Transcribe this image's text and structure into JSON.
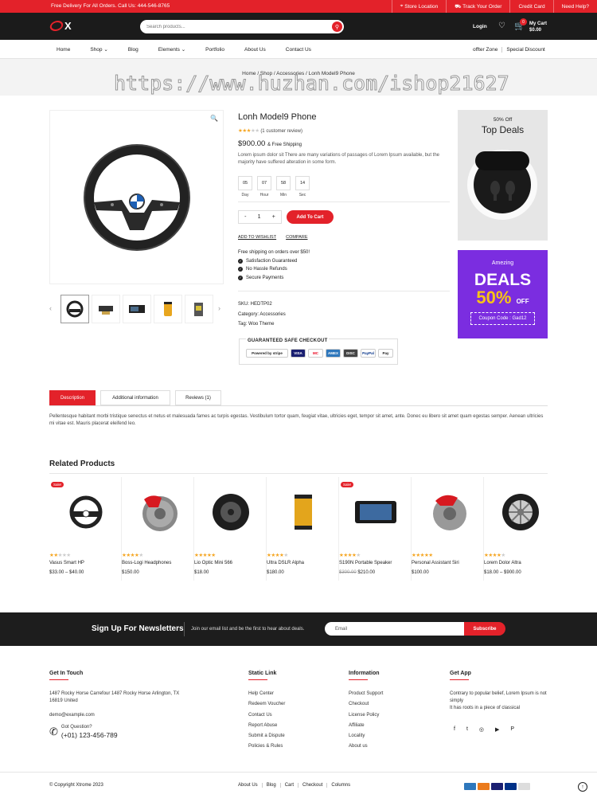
{
  "topbar": {
    "promo": "Free Delivery For All Orders. Call Us: 444-546-8765",
    "links": [
      "Store Location",
      "Track Your Order",
      "Credit Card",
      "Need Help?"
    ]
  },
  "header": {
    "logo": "X",
    "search_placeholder": "Search products...",
    "login": "Login",
    "cart_count": "0",
    "cart_label": "My Cart",
    "cart_total": "$0.00"
  },
  "nav": {
    "items": [
      "Home",
      "Shop ⌄",
      "Blog",
      "Elements ⌄",
      "Portfolio",
      "About Us",
      "Contact Us"
    ],
    "right": [
      "offter Zone",
      "Special Discount"
    ]
  },
  "breadcrumb": "Home / Shop / Accessories / Lonh Model9 Phone",
  "watermark": "https://www.huzhan.com/ishop21627",
  "product": {
    "title": "Lonh Model9 Phone",
    "rating": 3,
    "review": "(1 customer review)",
    "price": "$900.00",
    "shipping": "& Free Shipping",
    "description": "Lorem ipsum dolor sit There are many variations of passages of Lorem Ipsum available, but the majority have suffered alteration in some form.",
    "timer": [
      {
        "value": "05",
        "unit": "Day"
      },
      {
        "value": "07",
        "unit": "Hour"
      },
      {
        "value": "58",
        "unit": "Min"
      },
      {
        "value": "14",
        "unit": "Sec"
      }
    ],
    "qty": "1",
    "qty_minus": "-",
    "qty_plus": "+",
    "add_to_cart": "Add To Cart",
    "wishlist": "ADD TO WISHLIST",
    "compare": "COMPARE",
    "shipping_note": "Free shipping on orders over $50!",
    "features": [
      "Satisfaction Guaranteed",
      "No Hassle Refunds",
      "Secure Payments"
    ],
    "sku": "SKU: HEDTP02",
    "category": "Category: Accessories",
    "tag": "Tag: Woo Theme",
    "safe_title": "GUARANTEED SAFE CHECKOUT",
    "payments": [
      "Powered by stripe",
      "VISA",
      "MC",
      "AMEX",
      "DISC",
      "PayPal",
      "Pay"
    ]
  },
  "deals": {
    "off": "50% Off",
    "top": "Top Deals",
    "amezing": "Amezing",
    "deals_word": "DEALS",
    "percent": "50%",
    "off_word": "OFF",
    "coupon": "Coupon Code : Gad12"
  },
  "tabs": [
    "Description",
    "Additional information",
    "Reviews (1)"
  ],
  "tab_text": "Pellentesque habitant morbi tristique senectus et netus et malesuada fames ac turpis egestas. Vestibulum tortor quam, feugiat vitae, ultricies eget, tempor sit amet, ante. Donec eu libero sit amet quam egestas semper. Aenean ultricies mi vitae est. Mauris placerat eleifend leo.",
  "related": {
    "title": "Related Products",
    "items": [
      {
        "name": "Vasus Smart HP",
        "price": "$33.00 – $40.00",
        "old": "",
        "stars": 2,
        "sale": "Sale!"
      },
      {
        "name": "Boss-Logi Headphones",
        "price": "$150.00",
        "old": "",
        "stars": 4,
        "sale": ""
      },
      {
        "name": "Lio Optic Mini 566",
        "price": "$18.00",
        "old": "",
        "stars": 5,
        "sale": ""
      },
      {
        "name": "Ultra DSLR Alpha",
        "price": "$180.00",
        "old": "",
        "stars": 4,
        "sale": ""
      },
      {
        "name": "S190N Portable Speaker",
        "price": "$210.00",
        "old": "$300.00",
        "stars": 4,
        "sale": "Sale!"
      },
      {
        "name": "Personal Assistant Siri",
        "price": "$100.00",
        "old": "",
        "stars": 5,
        "sale": ""
      },
      {
        "name": "Lorem Dolor Altra",
        "price": "$18.00 – $900.00",
        "old": "",
        "stars": 4,
        "sale": ""
      }
    ]
  },
  "newsletter": {
    "title": "Sign Up For Newsletters",
    "sub": "Join our email list and be the first to hear about deals.",
    "email": "Email",
    "button": "Subscribe"
  },
  "footer": {
    "touch_title": "Get In Touch",
    "address": "1487 Rocky Horse Carrefour 1487 Rocky Horse Arlington, TX 16819 United",
    "email": "demo@example.com",
    "question": "Got Question?",
    "phone": "(+01) 123-456-789",
    "static_title": "Static Link",
    "static_links": [
      "Help Center",
      "Redeem Voucher",
      "Contact Us",
      "Report Abuse",
      "Submit a Dispute",
      "Policies & Rules"
    ],
    "info_title": "Information",
    "info_links": [
      "Product Support",
      "Checkout",
      "License Policy",
      "Affiliate",
      "Locality",
      "About us"
    ],
    "app_title": "Get App",
    "app_text1": "Contrary to popular belief, Lorem Ipsum is not simply",
    "app_text2": "It has roots in a piece of classical",
    "social": [
      "f",
      "t",
      "◎",
      "▶",
      "P"
    ],
    "copyright": "© Copyright Xtrome 2023",
    "bottom_links": [
      "About Us",
      "Blog",
      "Cart",
      "Checkout",
      "Columns"
    ],
    "to_top": "↑"
  },
  "colors": {
    "accent": "#e3222a",
    "dark": "#1b1b1b",
    "purple": "#7b2de0"
  }
}
